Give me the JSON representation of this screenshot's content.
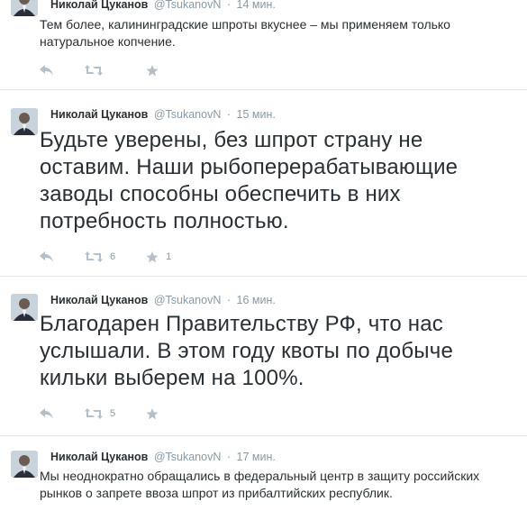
{
  "tweets": [
    {
      "author": "Николай Цуканов",
      "handle": "@TsukanovN",
      "separator": "·",
      "time": "14 мин.",
      "text": "Тем более, калининградские шпроты вкуснее – мы применяем только натуральное копчение.",
      "retweets": "",
      "favorites": ""
    },
    {
      "author": "Николай Цуканов",
      "handle": "@TsukanovN",
      "separator": "·",
      "time": "15 мин.",
      "text": "Будьте уверены, без шпрот страну не оставим. Наши рыбоперерабатывающие заводы способны обеспечить в них потребность полностью.",
      "retweets": "6",
      "favorites": "1"
    },
    {
      "author": "Николай Цуканов",
      "handle": "@TsukanovN",
      "separator": "·",
      "time": "16 мин.",
      "text": "Благодарен Правительству РФ, что нас услышали. В этом году квоты по добыче кильки выберем на 100%.",
      "retweets": "5",
      "favorites": ""
    },
    {
      "author": "Николай Цуканов",
      "handle": "@TsukanovN",
      "separator": "·",
      "time": "17 мин.",
      "text": "Мы неоднократно обращались в федеральный центр в защиту российских рынков о запрете ввоза шпрот из прибалтийских республик.",
      "retweets": "",
      "favorites": ""
    }
  ],
  "icons": {
    "reply": "reply-icon",
    "retweet": "retweet-icon",
    "favorite": "star-icon"
  },
  "colors": {
    "name": "#292f33",
    "muted": "#8899a6",
    "action_icon": "#b4bfc8",
    "divider": "#e1e8ed"
  }
}
